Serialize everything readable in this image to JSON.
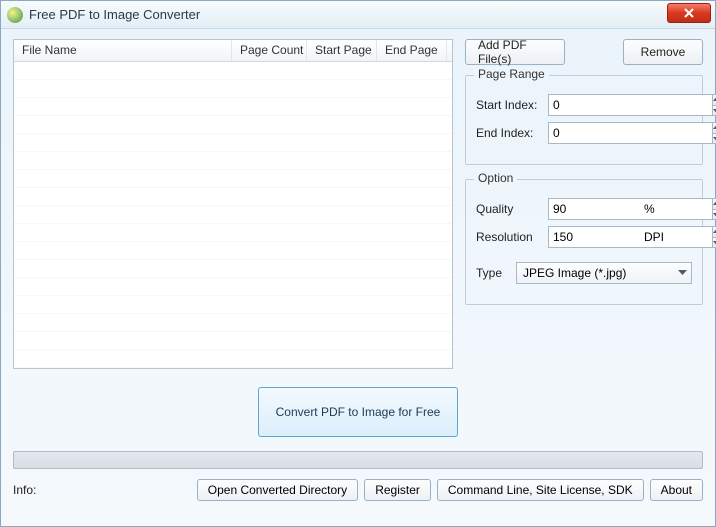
{
  "window": {
    "title": "Free PDF to Image Converter"
  },
  "file_list": {
    "columns": {
      "filename": "File Name",
      "pagecount": "Page Count",
      "startpage": "Start Page",
      "endpage": "End Page"
    }
  },
  "buttons": {
    "add_pdf": "Add PDF File(s)",
    "remove": "Remove",
    "convert": "Convert PDF to Image for Free",
    "open_dir": "Open Converted Directory",
    "register": "Register",
    "command_line": "Command Line, Site License, SDK",
    "about": "About"
  },
  "page_range": {
    "legend": "Page Range",
    "start_label": "Start Index:",
    "start_value": "0",
    "end_label": "End Index:",
    "end_value": "0"
  },
  "option": {
    "legend": "Option",
    "quality_label": "Quality",
    "quality_value": "90",
    "quality_unit": "%",
    "resolution_label": "Resolution",
    "resolution_value": "150",
    "resolution_unit": "DPI",
    "type_label": "Type",
    "type_value": "JPEG Image (*.jpg)"
  },
  "info_label": "Info:"
}
